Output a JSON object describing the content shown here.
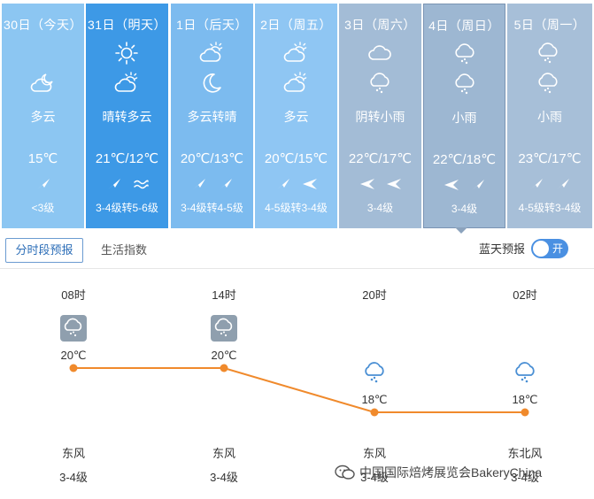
{
  "days": [
    {
      "date": "30日（今天）",
      "icons": [
        "cloudy-moon-icon"
      ],
      "desc": "多云",
      "temp": "15℃",
      "wind": [
        "wind-arrow-ne-icon"
      ],
      "level": "<3级",
      "bg": "#8cc6f2"
    },
    {
      "date": "31日（明天）",
      "icons": [
        "sun-icon",
        "partly-cloudy-icon"
      ],
      "desc": "晴转多云",
      "temp": "21℃/12℃",
      "wind": [
        "wind-arrow-ne-icon",
        "wind-waves-icon"
      ],
      "level": "3-4级转5-6级",
      "bg": "#3d99e6"
    },
    {
      "date": "1日（后天）",
      "icons": [
        "partly-cloudy-icon",
        "moon-icon"
      ],
      "desc": "多云转晴",
      "temp": "20℃/13℃",
      "wind": [
        "wind-arrow-ne-icon",
        "wind-arrow-ne-icon"
      ],
      "level": "3-4级转4-5级",
      "bg": "#7cbbef"
    },
    {
      "date": "2日（周五）",
      "icons": [
        "partly-cloudy-icon",
        "partly-cloudy-icon"
      ],
      "desc": "多云",
      "temp": "20℃/15℃",
      "wind": [
        "wind-arrow-ne-icon",
        "wind-arrow-w-icon"
      ],
      "level": "4-5级转3-4级",
      "bg": "#8fc6f3"
    },
    {
      "date": "3日（周六）",
      "icons": [
        "cloud-icon",
        "rain-cloud-icon"
      ],
      "desc": "阴转小雨",
      "temp": "22℃/17℃",
      "wind": [
        "wind-arrow-w-icon",
        "wind-arrow-w-icon"
      ],
      "level": "3-4级",
      "bg": "#a3bcd6"
    },
    {
      "date": "4日（周日）",
      "icons": [
        "rain-cloud-icon",
        "rain-cloud-icon"
      ],
      "desc": "小雨",
      "temp": "22℃/18℃",
      "wind": [
        "wind-arrow-w-icon",
        "wind-arrow-ne-icon"
      ],
      "level": "3-4级",
      "bg": "#9db7d2"
    },
    {
      "date": "5日（周一）",
      "icons": [
        "rain-cloud-icon",
        "rain-cloud-icon"
      ],
      "desc": "小雨",
      "temp": "23℃/17℃",
      "wind": [
        "wind-arrow-ne-icon",
        "wind-arrow-ne-icon"
      ],
      "level": "4-5级转3-4级",
      "bg": "#a7bfd8"
    }
  ],
  "tabs": {
    "active": "分时段预报",
    "other": "生活指数",
    "blue_sky_label": "蓝天预报",
    "toggle_label": "开"
  },
  "hourly": [
    {
      "time": "08时",
      "icon": "rain-cloud-gray-icon",
      "temp": "20℃",
      "wind": "东风",
      "level": "3-4级"
    },
    {
      "time": "14时",
      "icon": "rain-cloud-gray-icon",
      "temp": "20℃",
      "wind": "东风",
      "level": "3-4级"
    },
    {
      "time": "20时",
      "icon": "rain-cloud-blue-icon",
      "temp": "18℃",
      "wind": "东风",
      "level": "3-4级"
    },
    {
      "time": "02时",
      "icon": "rain-cloud-blue-icon",
      "temp": "18℃",
      "wind": "东北风",
      "level": "3-4级"
    }
  ],
  "hourly_temps": [
    20,
    20,
    18,
    18
  ],
  "watermark": "中国国际焙烤展览会BakeryChina",
  "colors": {
    "selected_border": "#7a94b3",
    "line": "#f08a2c",
    "tab_active": "#2e6fb8",
    "toggle": "#4a90e2"
  }
}
